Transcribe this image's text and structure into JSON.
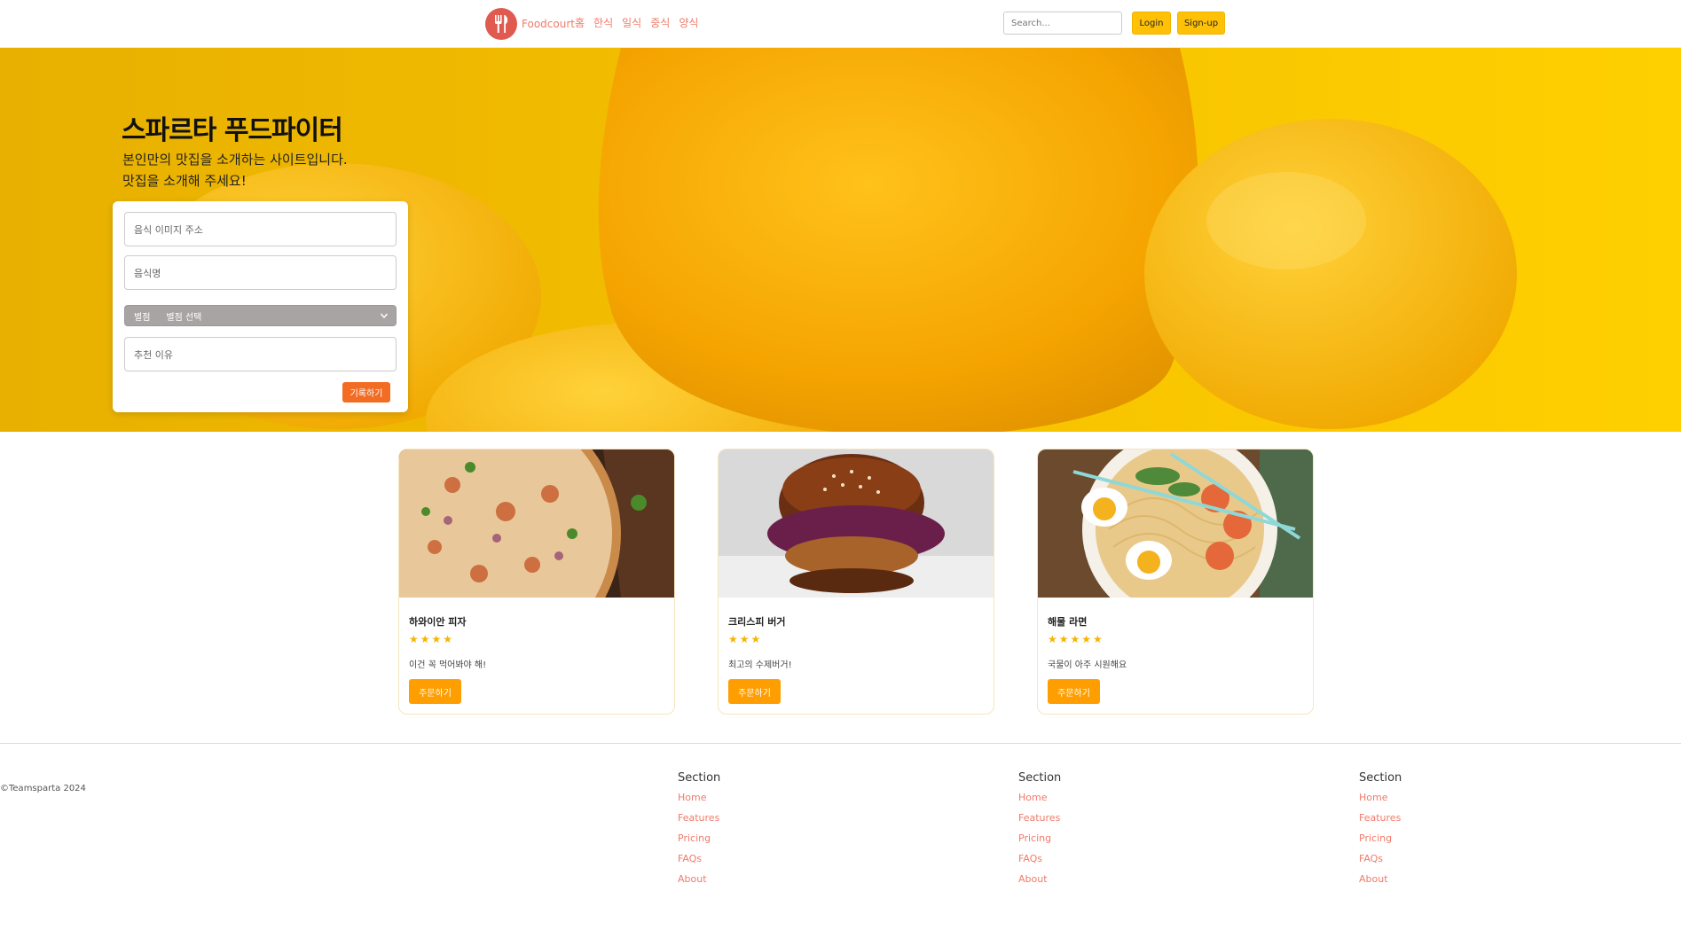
{
  "nav": {
    "brand": "Foodcourt",
    "links": [
      "홈",
      "한식",
      "일식",
      "중식",
      "양식"
    ],
    "search_placeholder": "Search...",
    "login": "Login",
    "signup": "Sign-up"
  },
  "hero": {
    "title": "스파르타 푸드파이터",
    "subtitle_line1": "본인만의 맛집을 소개하는 사이트입니다.",
    "subtitle_line2": "맛집을 소개해 주세요!"
  },
  "form": {
    "image_placeholder": "음식 이미지 주소",
    "name_placeholder": "음식명",
    "rating_label": "별점",
    "rating_selected": "별점 선택",
    "reason_placeholder": "추천 이유",
    "submit": "기록하기"
  },
  "cards": [
    {
      "title": "하와이안 피자",
      "stars": "★★★★",
      "desc": "이건 꼭 먹어봐야 해!",
      "button": "주문하기",
      "rating": 4
    },
    {
      "title": "크리스피 버거",
      "stars": "★★★",
      "desc": "최고의 수제버거!",
      "button": "주문하기",
      "rating": 3
    },
    {
      "title": "해물 라면",
      "stars": "★★★★★",
      "desc": "국물이 아주 시원해요",
      "button": "주문하기",
      "rating": 5
    }
  ],
  "footer": {
    "copyright": "©Teamsparta 2024",
    "sections": [
      {
        "heading": "Section",
        "links": [
          "Home",
          "Features",
          "Pricing",
          "FAQs",
          "About"
        ]
      },
      {
        "heading": "Section",
        "links": [
          "Home",
          "Features",
          "Pricing",
          "FAQs",
          "About"
        ]
      },
      {
        "heading": "Section",
        "links": [
          "Home",
          "Features",
          "Pricing",
          "FAQs",
          "About"
        ]
      }
    ]
  },
  "colors": {
    "accent": "#f07a6a",
    "yellow": "#ffc107",
    "orange": "#ff9e00",
    "record": "#f36c24"
  }
}
